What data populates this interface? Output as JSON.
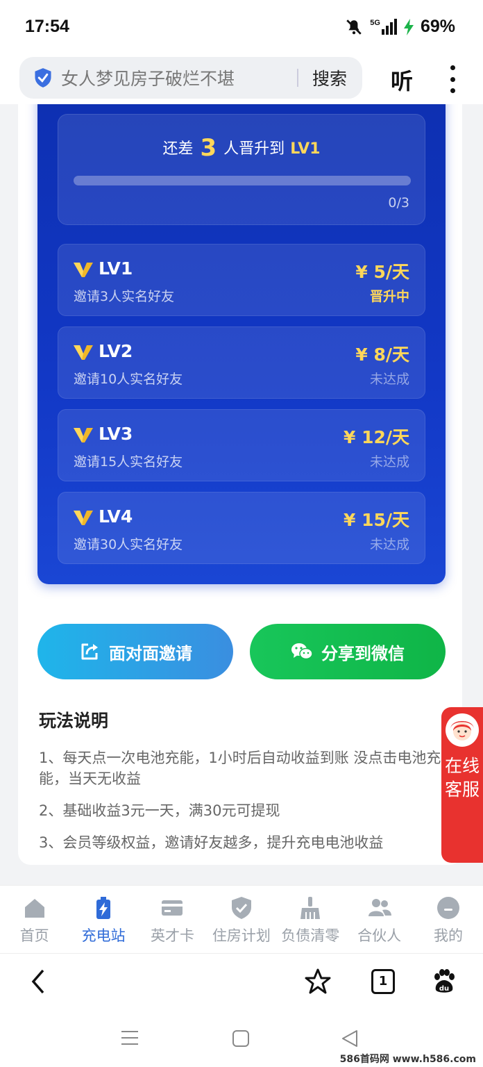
{
  "status": {
    "time": "17:54",
    "network": "5G",
    "battery": "69%"
  },
  "browser": {
    "search_placeholder": "女人梦见房子破烂不堪",
    "search_button": "搜索",
    "listen_button": "听",
    "tab_count": "1"
  },
  "progress": {
    "prefix": "还差",
    "remaining": "3",
    "middle": "人晋升到",
    "target_level": "LV1",
    "count_text": "0/3",
    "fraction": 0
  },
  "levels": [
    {
      "name": "LV1",
      "desc": "邀请3人实名好友",
      "price": "¥ 5/天",
      "status": "晋升中"
    },
    {
      "name": "LV2",
      "desc": "邀请10人实名好友",
      "price": "¥ 8/天",
      "status": "未达成"
    },
    {
      "name": "LV3",
      "desc": "邀请15人实名好友",
      "price": "¥ 12/天",
      "status": "未达成"
    },
    {
      "name": "LV4",
      "desc": "邀请30人实名好友",
      "price": "¥ 15/天",
      "status": "未达成"
    }
  ],
  "buttons": {
    "invite": "面对面邀请",
    "wechat": "分享到微信"
  },
  "rules": {
    "title": "玩法说明",
    "items": [
      "1、每天点一次电池充能，1小时后自动收益到账 没点击电池充能，当天无收益",
      "2、基础收益3元一天，满30元可提现",
      "3、会员等级权益，邀请好友越多，提升充电电池收益"
    ]
  },
  "service": {
    "label": "在线客服"
  },
  "tabs": [
    {
      "label": "首页",
      "icon": "home-icon"
    },
    {
      "label": "充电站",
      "icon": "battery-charging-icon"
    },
    {
      "label": "英才卡",
      "icon": "card-icon"
    },
    {
      "label": "住房计划",
      "icon": "shield-check-icon"
    },
    {
      "label": "负债清零",
      "icon": "broom-icon"
    },
    {
      "label": "合伙人",
      "icon": "users-icon"
    },
    {
      "label": "我的",
      "icon": "profile-icon"
    }
  ],
  "colors": {
    "accent_gold": "#ffd75a",
    "panel_blue": "#1238c6",
    "active_tab": "#2f6bd8",
    "wechat_green": "#18c65a",
    "service_red": "#e8322f"
  },
  "watermark": "586首码网 www.h586.com"
}
